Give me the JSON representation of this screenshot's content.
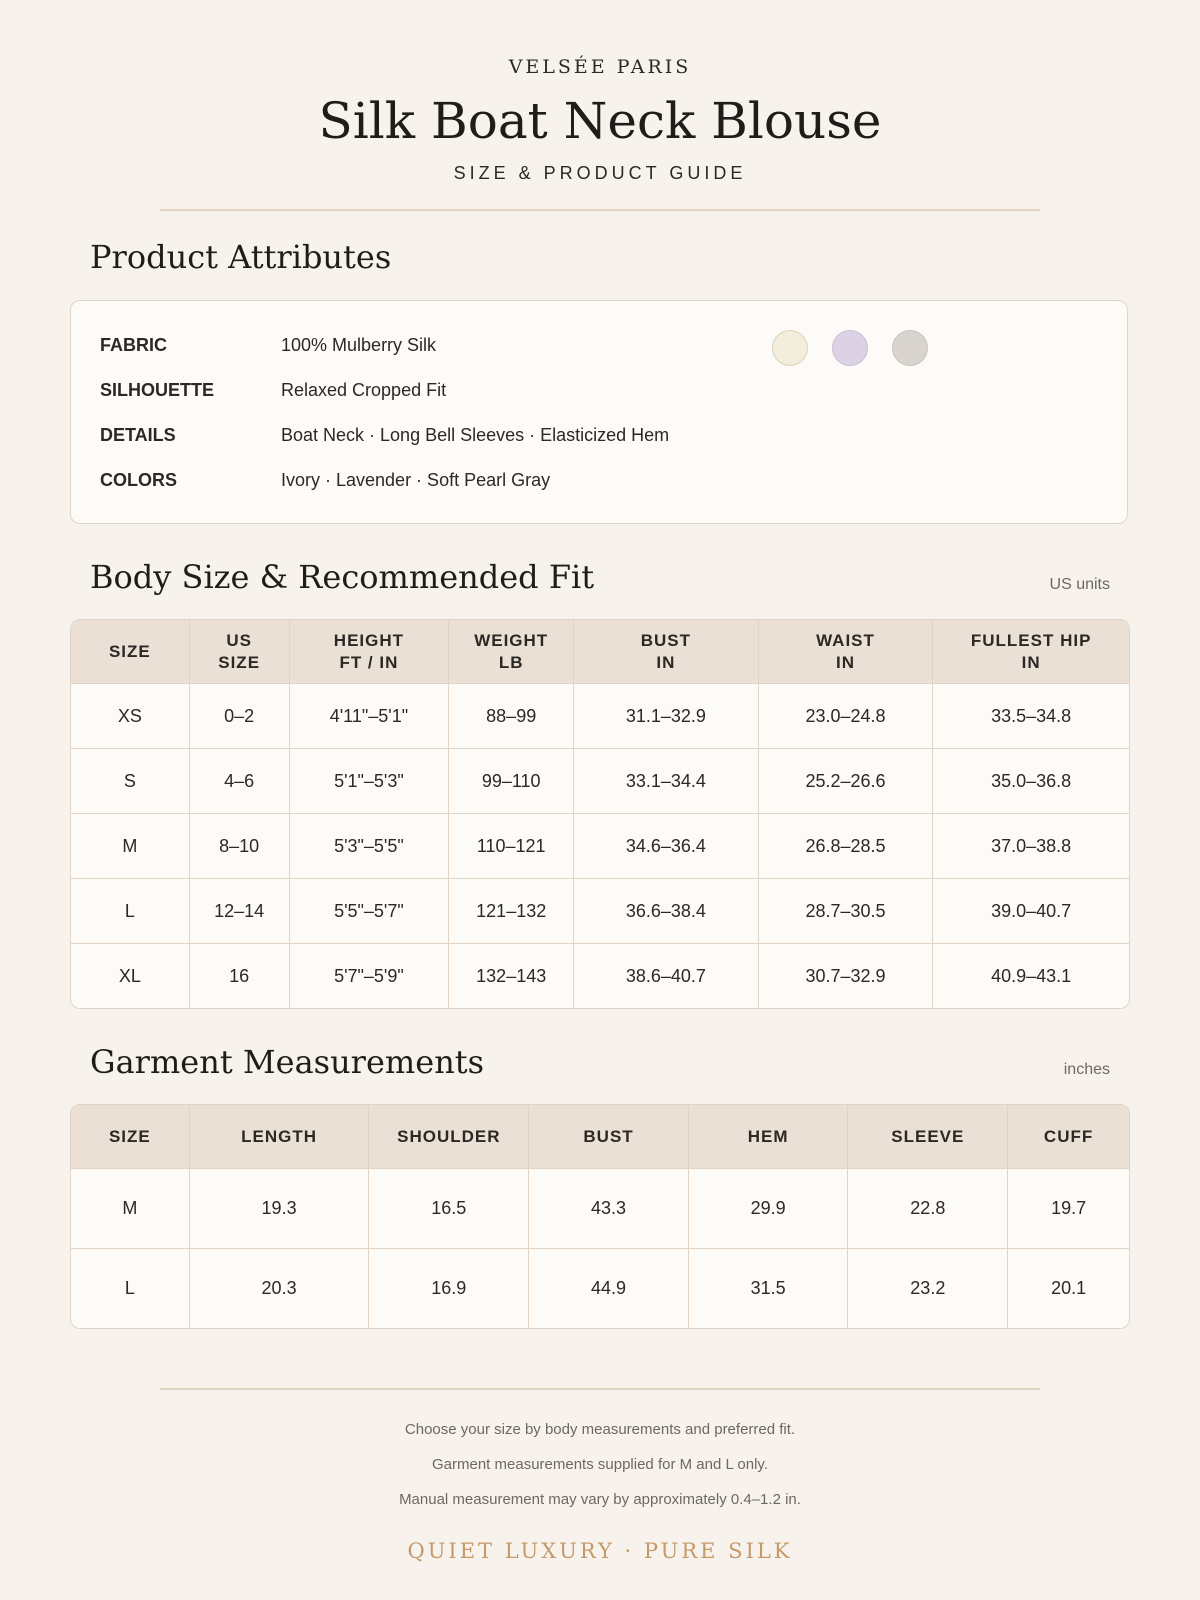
{
  "header": {
    "brand": "VELSÉE PARIS",
    "title": "Silk Boat Neck Blouse",
    "subtitle": "SIZE & PRODUCT GUIDE"
  },
  "attributes": {
    "title": "Product Attributes",
    "rows": [
      {
        "label": "FABRIC",
        "value": "100% Mulberry Silk"
      },
      {
        "label": "SILHOUETTE",
        "value": "Relaxed Cropped Fit"
      },
      {
        "label": "DETAILS",
        "value": "Boat Neck · Long Bell Sleeves · Elasticized Hem"
      },
      {
        "label": "COLORS",
        "value": "Ivory · Lavender · Soft Pearl Gray"
      }
    ],
    "swatches": [
      {
        "name": "Ivory",
        "color": "#f3eddc",
        "border": "#ded3bd"
      },
      {
        "name": "Lavender",
        "color": "#dcd2e3",
        "border": "#cbbfd6"
      },
      {
        "name": "Soft Pearl Gray",
        "color": "#d9d4ce",
        "border": "#c9c3bd"
      }
    ]
  },
  "body_size": {
    "title": "Body Size & Recommended Fit",
    "unit_note": "US units",
    "headers": [
      [
        "SIZE"
      ],
      [
        "US",
        "SIZE"
      ],
      [
        "HEIGHT",
        "FT / IN"
      ],
      [
        "WEIGHT",
        "LB"
      ],
      [
        "BUST",
        "IN"
      ],
      [
        "WAIST",
        "IN"
      ],
      [
        "FULLEST HIP",
        "IN"
      ]
    ],
    "rows": [
      [
        "XS",
        "0–2",
        "4'11\"–5'1\"",
        "88–99",
        "31.1–32.9",
        "23.0–24.8",
        "33.5–34.8"
      ],
      [
        "S",
        "4–6",
        "5'1\"–5'3\"",
        "99–110",
        "33.1–34.4",
        "25.2–26.6",
        "35.0–36.8"
      ],
      [
        "M",
        "8–10",
        "5'3\"–5'5\"",
        "110–121",
        "34.6–36.4",
        "26.8–28.5",
        "37.0–38.8"
      ],
      [
        "L",
        "12–14",
        "5'5\"–5'7\"",
        "121–132",
        "36.6–38.4",
        "28.7–30.5",
        "39.0–40.7"
      ],
      [
        "XL",
        "16",
        "5'7\"–5'9\"",
        "132–143",
        "38.6–40.7",
        "30.7–32.9",
        "40.9–43.1"
      ]
    ]
  },
  "garment": {
    "title": "Garment Measurements",
    "unit_note": "inches",
    "headers": [
      "SIZE",
      "LENGTH",
      "SHOULDER",
      "BUST",
      "HEM",
      "SLEEVE",
      "CUFF"
    ],
    "rows": [
      [
        "M",
        "19.3",
        "16.5",
        "43.3",
        "29.9",
        "22.8",
        "19.7"
      ],
      [
        "L",
        "20.3",
        "16.9",
        "44.9",
        "31.5",
        "23.2",
        "20.1"
      ]
    ]
  },
  "footer": {
    "notes": [
      "Choose your size by body measurements and preferred fit.",
      "Garment measurements supplied for M and L only.",
      "Manual measurement may vary by approximately 0.4–1.2 in."
    ],
    "tagline": "QUIET LUXURY · PURE SILK"
  }
}
